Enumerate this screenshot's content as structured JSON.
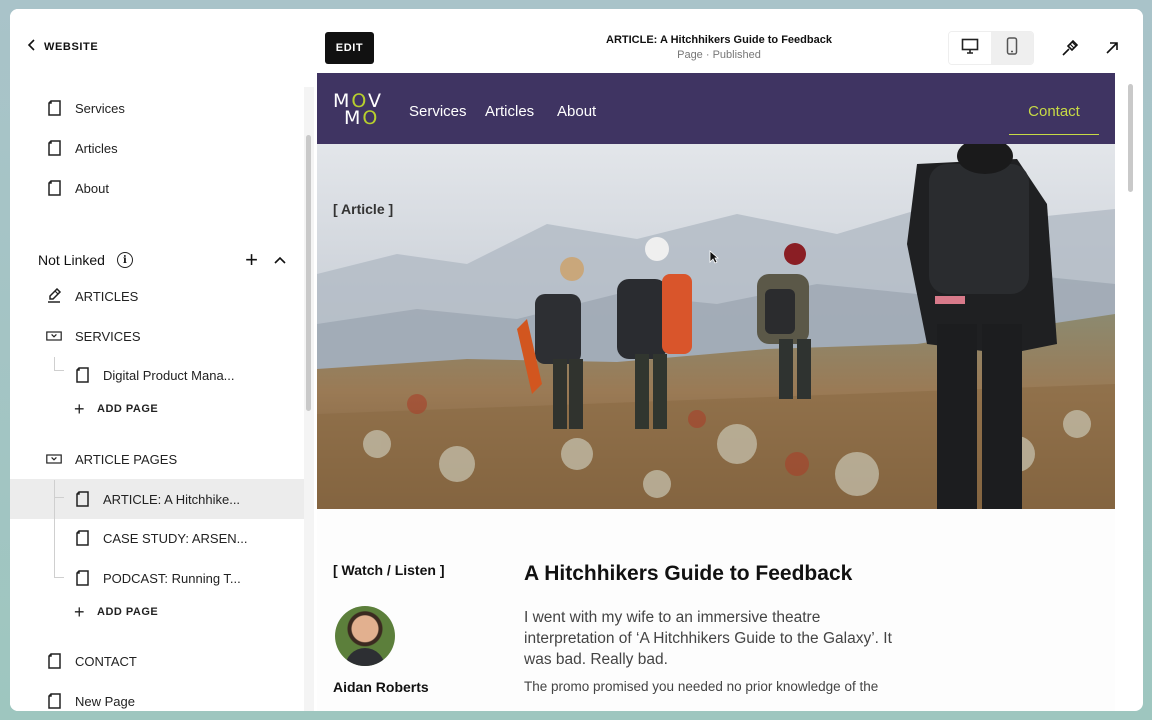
{
  "sidebar": {
    "back_label": "WEBSITE",
    "top_items": [
      {
        "label": "Services",
        "icon": "page-icon"
      },
      {
        "label": "Articles",
        "icon": "page-icon"
      },
      {
        "label": "About",
        "icon": "page-icon"
      }
    ],
    "not_linked": {
      "label": "Not Linked"
    },
    "articles": {
      "label": "ARTICLES",
      "icon": "blog-icon"
    },
    "services": {
      "label": "SERVICES",
      "icon": "collection-icon"
    },
    "services_children": [
      {
        "label": "Digital Product Mana..."
      }
    ],
    "add_page_label": "ADD PAGE",
    "article_pages": {
      "label": "ARTICLE PAGES",
      "icon": "collection-icon"
    },
    "article_pages_children": [
      {
        "label": "ARTICLE: A Hitchhike...",
        "active": true
      },
      {
        "label": "CASE STUDY: ARSEN..."
      },
      {
        "label": "PODCAST: Running T..."
      }
    ],
    "bottom_items": [
      {
        "label": "CONTACT"
      },
      {
        "label": "New Page"
      }
    ]
  },
  "topbar": {
    "edit_label": "EDIT",
    "page_title": "ARTICLE: A Hitchhikers Guide to Feedback",
    "page_status": "Page · Published",
    "view_modes": [
      "desktop-icon",
      "mobile-icon"
    ],
    "selected_view": "desktop-icon",
    "tools": [
      "brush-icon",
      "open-external-icon"
    ]
  },
  "site": {
    "logo_line1": [
      "M",
      "O",
      "V"
    ],
    "logo_line2": [
      "M",
      "O"
    ],
    "accent_color": "#b7cf2d",
    "nav_color": "#3f3462",
    "nav_links": [
      "Services",
      "Articles",
      "About"
    ],
    "contact_label": "Contact",
    "hero_label": "[ Article ]",
    "watch_label": "[ Watch / Listen ]",
    "author_name": "Aidan Roberts",
    "article_title": "A Hitchhikers Guide to Feedback",
    "article_intro": "I went with my wife to an immersive theatre interpretation of ‘A Hitchhikers Guide to the Galaxy’. It was bad. Really bad.",
    "article_body_start": "The promo promised you needed no prior knowledge of the"
  }
}
